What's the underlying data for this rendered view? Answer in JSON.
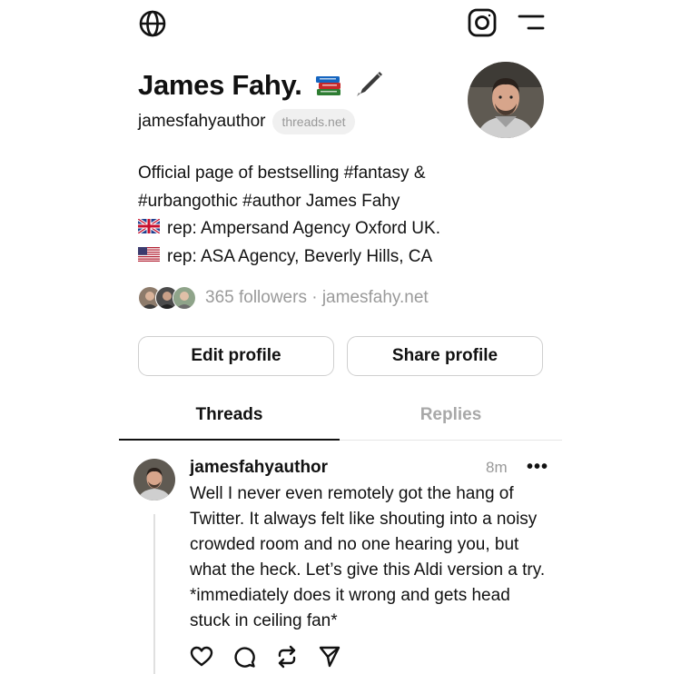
{
  "header": {
    "globe_icon": "globe-icon",
    "instagram_icon": "instagram-icon",
    "menu_icon": "menu-icon"
  },
  "profile": {
    "name": "James Fahy.",
    "name_emojis": [
      "books-emoji",
      "fountain-pen-emoji"
    ],
    "handle": "jamesfahyauthor",
    "domain_chip": "threads.net",
    "bio": [
      {
        "text": "Official page of bestselling #fantasy &"
      },
      {
        "text": "#urbangothic #author James Fahy"
      },
      {
        "flag": "uk-flag",
        "text": "rep: Ampersand Agency Oxford UK."
      },
      {
        "flag": "us-flag",
        "text": "rep: ASA Agency, Beverly Hills, CA"
      }
    ],
    "followers_text": "365 followers · jamesfahy.net"
  },
  "buttons": {
    "edit": "Edit profile",
    "share": "Share profile"
  },
  "tabs": [
    {
      "label": "Threads",
      "active": true
    },
    {
      "label": "Replies",
      "active": false
    }
  ],
  "post": {
    "user": "jamesfahyauthor",
    "time": "8m",
    "more": "•••",
    "text": "Well I never even remotely got the hang of Twitter. It always felt like shouting into a noisy crowded room and no one hearing you, but what the heck. Let’s give this Aldi version a try. *immediately does it wrong and gets head stuck in ceiling fan*",
    "actions": [
      "heart-icon",
      "comment-icon",
      "repost-icon",
      "send-icon"
    ]
  }
}
